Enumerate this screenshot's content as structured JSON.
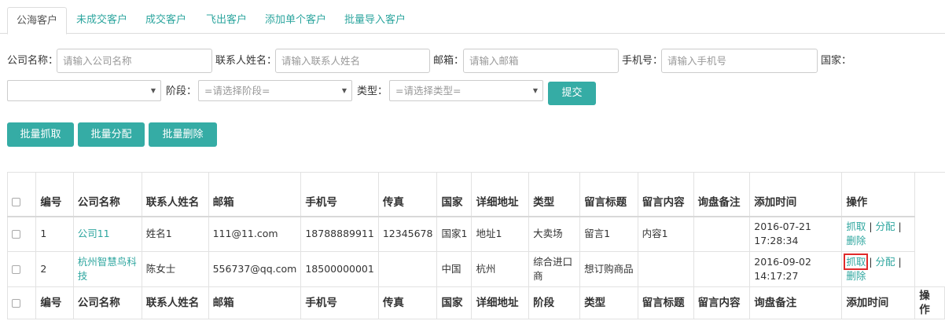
{
  "tabs": [
    "公海客户",
    "未成交客户",
    "成交客户",
    "飞出客户",
    "添加单个客户",
    "批量导入客户"
  ],
  "filters": {
    "company_label": "公司名称：",
    "company_placeholder": "请输入公司名称",
    "contact_label": "联系人姓名：",
    "contact_placeholder": "请输入联系人姓名",
    "email_label": "邮箱：",
    "email_placeholder": "请输入邮箱",
    "phone_label": "手机号：",
    "phone_placeholder": "请输入手机号",
    "country_label": "国家：",
    "country_value": "",
    "stage_label": "阶段：",
    "stage_value": "=请选择阶段=",
    "type_label": "类型：",
    "type_value": "=请选择类型=",
    "submit_label": "提交"
  },
  "bulk_actions": {
    "grab": "批量抓取",
    "assign": "批量分配",
    "delete": "批量删除"
  },
  "table": {
    "headers": [
      "编号",
      "公司名称",
      "联系人姓名",
      "邮箱",
      "手机号",
      "传真",
      "国家",
      "详细地址",
      "类型",
      "留言标题",
      "留言内容",
      "询盘备注",
      "添加时间",
      "操作"
    ],
    "footer_headers": [
      "编号",
      "公司名称",
      "联系人姓名",
      "邮箱",
      "手机号",
      "传真",
      "国家",
      "详细地址",
      "阶段",
      "类型",
      "留言标题",
      "留言内容",
      "询盘备注",
      "添加时间",
      "操作"
    ],
    "rows": [
      {
        "id": "1",
        "company": "公司11",
        "contact": "姓名1",
        "email": "111@11.com",
        "phone": "18788889911",
        "fax": "12345678",
        "country": "国家1",
        "address": "地址1",
        "type": "大卖场",
        "title": "留言1",
        "content": "内容1",
        "note": "",
        "time": "2016-07-21 17:28:34"
      },
      {
        "id": "2",
        "company": "杭州智慧鸟科技",
        "contact": "陈女士",
        "email": "556737@qq.com",
        "phone": "18500000001",
        "fax": "",
        "country": "中国",
        "address": "杭州",
        "type": "综合进口商",
        "title": "想订购商品",
        "content": "",
        "note": "",
        "time": "2016-09-02 14:17:27"
      }
    ],
    "actions": {
      "grab": "抓取",
      "sep": "|",
      "assign": "分配",
      "delete": "删除"
    }
  },
  "colors": {
    "accent": "#35aca5",
    "link": "#2ea69f",
    "highlight": "#e02a2a"
  },
  "icons": {
    "select_arrow": "chevron-down-icon"
  }
}
